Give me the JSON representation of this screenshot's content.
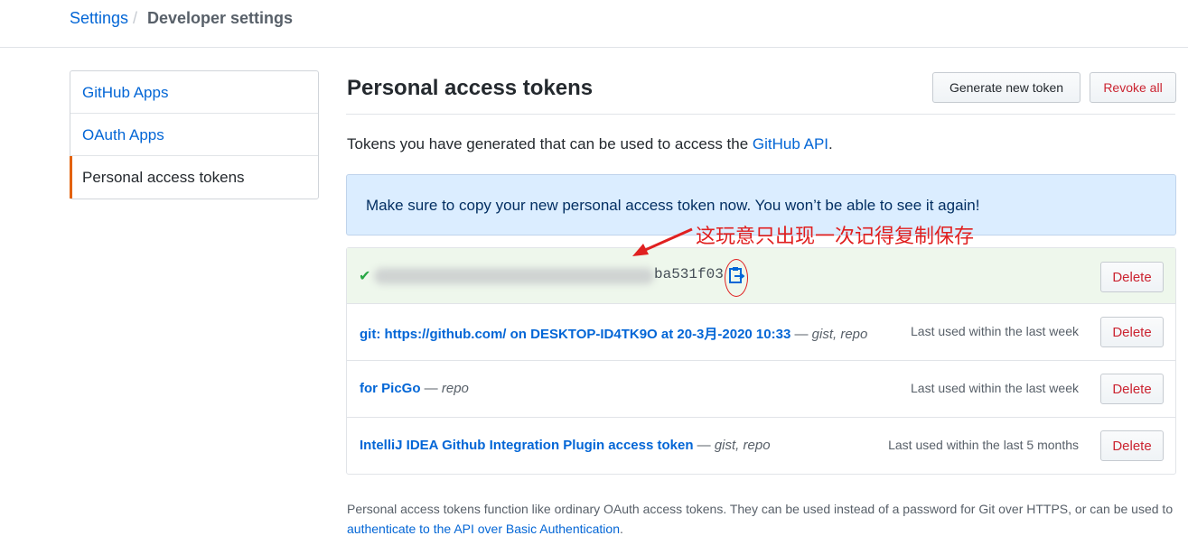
{
  "breadcrumb": {
    "root": "Settings",
    "separator": "/",
    "current": "Developer settings"
  },
  "sidebar": {
    "items": [
      {
        "label": "GitHub Apps"
      },
      {
        "label": "OAuth Apps"
      },
      {
        "label": "Personal access tokens"
      }
    ]
  },
  "main": {
    "title": "Personal access tokens",
    "generate_button": "Generate new token",
    "revoke_button": "Revoke all",
    "intro_text": "Tokens you have generated that can be used to access the ",
    "intro_link": "GitHub API",
    "intro_end": ".",
    "flash": "Make sure to copy your new personal access token now. You won’t be able to see it again!"
  },
  "new_token": {
    "visible_suffix": "ba531f03",
    "delete_label": "Delete"
  },
  "annotation": {
    "text": "这玩意只出现一次记得复制保存",
    "color": "#e02020"
  },
  "tokens": [
    {
      "name": "git: https://github.com/ on DESKTOP-ID4TK9O at 20-3月-2020 10:33",
      "dash": " — ",
      "scopes": "gist, repo",
      "last_used": "Last used within the last week",
      "delete_label": "Delete"
    },
    {
      "name": "for PicGo",
      "dash": " — ",
      "scopes": "repo",
      "last_used": "Last used within the last week",
      "delete_label": "Delete"
    },
    {
      "name": "IntelliJ IDEA Github Integration Plugin access token",
      "dash": " — ",
      "scopes": "gist, repo",
      "last_used": "Last used within the last 5 months",
      "delete_label": "Delete"
    }
  ],
  "footnote": {
    "text": "Personal access tokens function like ordinary OAuth access tokens. They can be used instead of a password for Git over HTTPS, or can be used to ",
    "link": "authenticate to the API over Basic Authentication",
    "end": "."
  },
  "icons": {
    "check": "check-icon",
    "copy": "clipboard-icon"
  },
  "colors": {
    "link": "#0366d6",
    "danger": "#cb2431",
    "success": "#28a745",
    "selected_accent": "#e36209"
  }
}
